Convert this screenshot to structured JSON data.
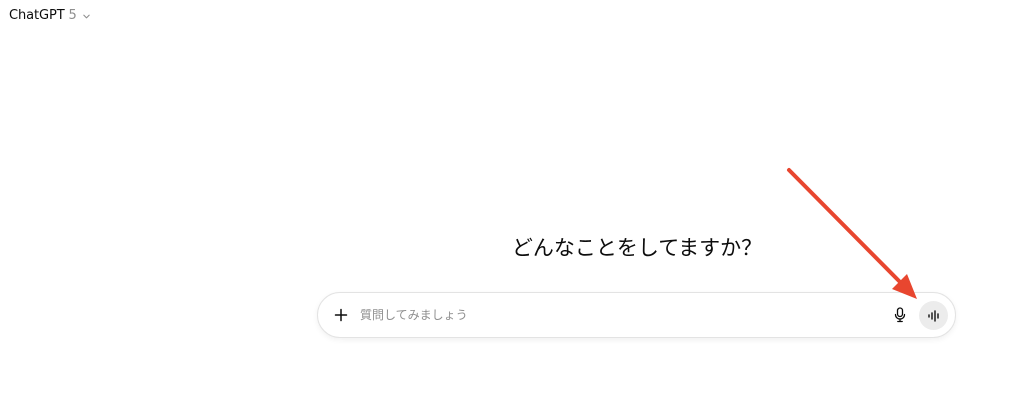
{
  "header": {
    "model_name": "ChatGPT",
    "model_version": "5",
    "chevron_icon": "chevron-down-icon"
  },
  "main": {
    "heading": "どんなことをしてますか？"
  },
  "composer": {
    "placeholder": "質問してみましょう",
    "value": "",
    "add_icon": "plus-icon",
    "mic_icon": "microphone-icon",
    "voice_icon": "voice-mode-icon"
  },
  "annotation": {
    "arrow_color": "#e8462f"
  },
  "colors": {
    "text_primary": "#0d0d0d",
    "text_muted": "#8f8f8f",
    "composer_border": "#e3e3e3",
    "voice_button_bg": "#ececec"
  }
}
